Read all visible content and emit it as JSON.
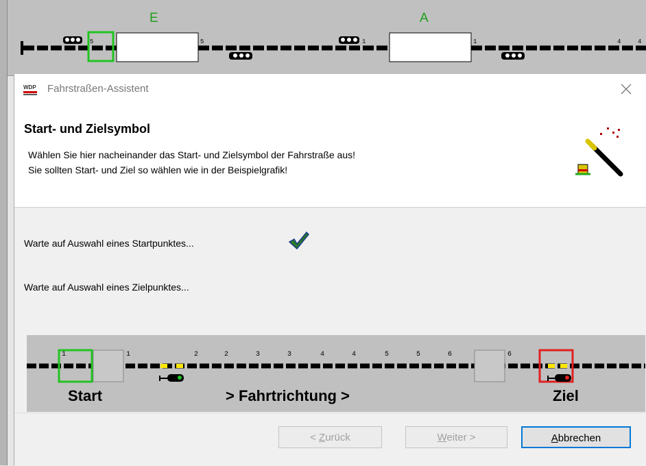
{
  "background": {
    "labels": [
      "E",
      "A"
    ],
    "track_numbers": [
      "5",
      "5",
      "1",
      "1",
      "4",
      "4"
    ],
    "colors": {
      "label": "#1e9e1e",
      "track": "#000000",
      "highlight": "#22c322"
    }
  },
  "dialog": {
    "title": "Fahrstraßen-Assistent",
    "header": {
      "title": "Start- und Zielsymbol",
      "line1": "Wählen Sie hier nacheinander das Start- und Zielsymbol der Fahrstraße aus!",
      "line2": "Sie sollten Start- und Ziel so wählen wie in der Beispielgrafik!"
    },
    "status": {
      "start": "Warte auf Auswahl eines Startpunktes...",
      "ziel": "Warte auf Auswahl eines Zielpunktes..."
    },
    "example": {
      "start_label": "Start",
      "direction_label": "> Fahrtrichtung >",
      "ziel_label": "Ziel",
      "numbers": [
        "1",
        "1",
        "2",
        "2",
        "3",
        "3",
        "4",
        "4",
        "5",
        "5",
        "6",
        "6"
      ]
    },
    "buttons": {
      "back": {
        "prefix": "< ",
        "accel": "Z",
        "rest": "urück"
      },
      "next": {
        "accel": "W",
        "rest": "eiter >"
      },
      "cancel": {
        "accel": "A",
        "rest": "bbrechen"
      }
    },
    "icons": {
      "app": "wdp-logo-icon",
      "close": "close-icon",
      "wand": "magic-wand-icon",
      "check": "checkmark-icon"
    },
    "colors": {
      "accent": "#0078d7",
      "start_box": "#22c322",
      "ziel_box": "#e02020"
    }
  }
}
